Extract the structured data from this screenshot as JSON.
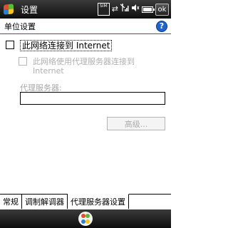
{
  "titlebar": {
    "title": "设置",
    "sim_text": "SIM",
    "ok_label": "ok"
  },
  "header": {
    "title": "单位设置",
    "help_label": "?"
  },
  "options": {
    "connect_internet_label": "此网络连接到 Internet",
    "connect_internet_checked": false,
    "use_proxy_label": "此网络使用代理服务器连接到 Internet",
    "use_proxy_checked": false,
    "use_proxy_enabled": false
  },
  "proxy": {
    "label": "代理服务器:",
    "value": ""
  },
  "advanced_button_label": "高级...",
  "tabs": [
    {
      "label": "常规",
      "active": false
    },
    {
      "label": "调制解调器",
      "active": false
    },
    {
      "label": "代理服务器设置",
      "active": true
    }
  ],
  "icons": {
    "start": "windows-flag-icon",
    "sim": "sim-card-icon",
    "connectivity": "sync-arrows-icon",
    "signal": "signal-strength-icon",
    "volume": "speaker-muted-icon",
    "battery": "battery-icon",
    "input": "input-panel-icon"
  },
  "colors": {
    "title_bar": "#0e0e0e",
    "header_rule": "#2a5aa8",
    "help_icon": "#1f64c8",
    "disabled_text": "#b0b0b0"
  }
}
